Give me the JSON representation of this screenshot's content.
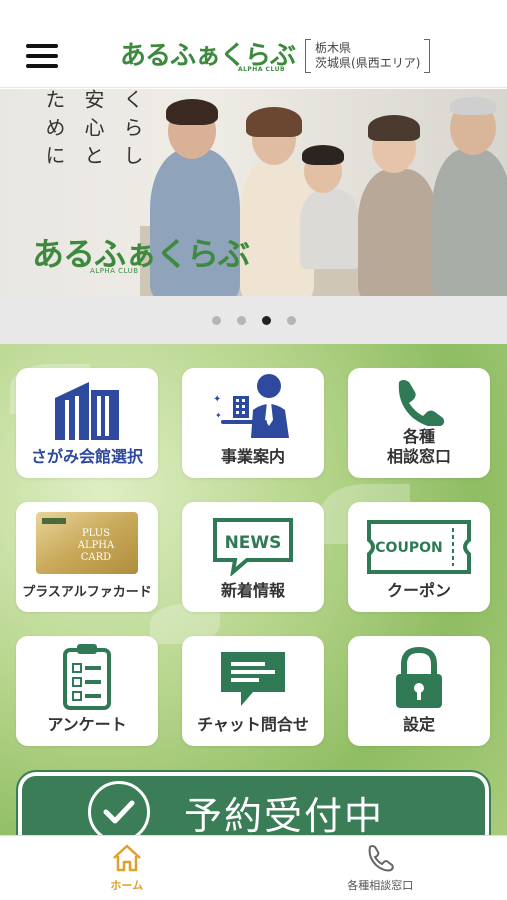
{
  "header": {
    "logo_text": "あるふぁくらぶ",
    "logo_sub": "ALPHA CLUB",
    "region_line1": "栃木県",
    "region_line2": "茨城県(県西エリア)"
  },
  "hero": {
    "copy_col1": "くらし",
    "copy_col2": "安心と",
    "copy_col3": "ために",
    "logo_text": "あるふぁくらぶ",
    "logo_sub": "ALPHA CLUB",
    "slide_count": 4,
    "active_slide": 3
  },
  "tiles": [
    {
      "label": "さがみ会館選択",
      "icon": "building-icon"
    },
    {
      "label": "事業案内",
      "icon": "concierge-icon"
    },
    {
      "label": "各種\n相談窓口",
      "label_line1": "各種",
      "label_line2": "相談窓口",
      "icon": "phone-icon"
    },
    {
      "label": "プラスアルファカード",
      "icon": "card-icon",
      "card_text1": "PLUS",
      "card_text2": "ALPHA",
      "card_text3": "CARD"
    },
    {
      "label": "新着情報",
      "icon": "news-icon",
      "badge": "NEWS"
    },
    {
      "label": "クーポン",
      "icon": "coupon-icon",
      "badge": "COUPON"
    },
    {
      "label": "アンケート",
      "icon": "clipboard-icon"
    },
    {
      "label": "チャット問合せ",
      "icon": "chat-icon"
    },
    {
      "label": "設定",
      "icon": "lock-icon"
    }
  ],
  "reserve": {
    "label": "予約受付中"
  },
  "tabbar": {
    "home_label": "ホーム",
    "consult_label": "各種相談窓口"
  },
  "colors": {
    "brand_green": "#3d8a3f",
    "tile_green": "#2f7a55",
    "tile_blue": "#2e4a9e",
    "active_tab": "#e0a02a"
  }
}
